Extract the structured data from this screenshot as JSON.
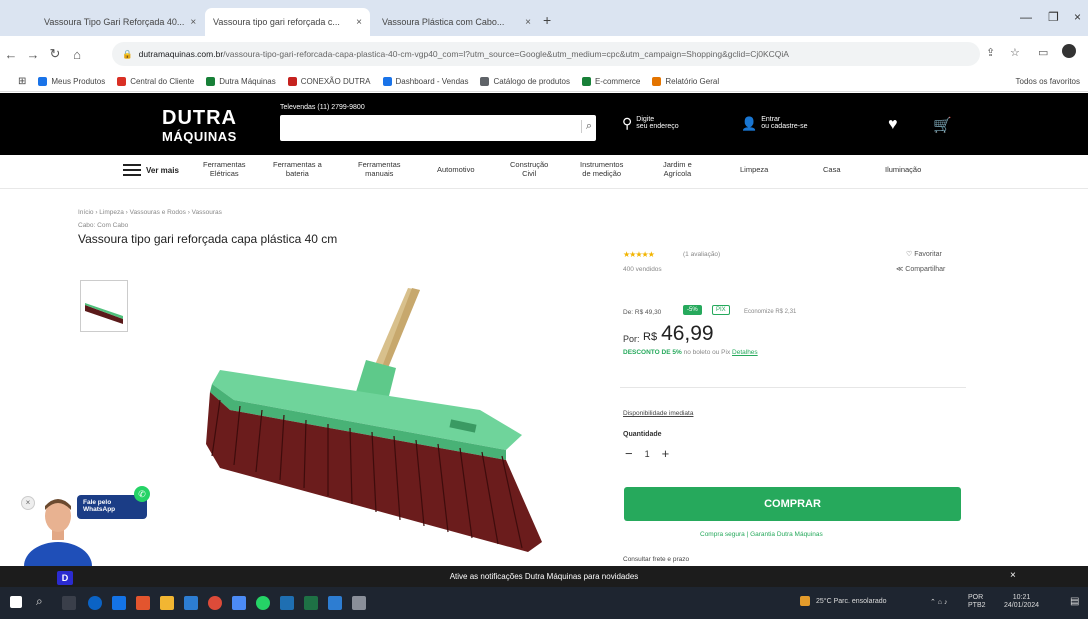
{
  "browser": {
    "tabs": [
      {
        "title": "Vassoura Tipo Gari Reforçada 40...",
        "color": "#e8a000"
      },
      {
        "title": "Vassoura tipo gari reforçada c...",
        "color": "#1a3d8f"
      },
      {
        "title": "Vassoura Plástica com Cabo...",
        "color": "#d0302c"
      }
    ],
    "url_host": "dutramaquinas.com.br",
    "url_path": "/vassoura-tipo-gari-reforcada-capa-plastica-40-cm-vgp40_com=l?utm_source=Google&utm_medium=cpc&utm_campaign=Shopping&gclid=Cj0KCQiA",
    "bookmarks": [
      {
        "label": "Meus Produtos",
        "color": "#1a73e8"
      },
      {
        "label": "Central do Cliente",
        "color": "#d93025"
      },
      {
        "label": "Dutra Máquinas",
        "color": "#188038"
      },
      {
        "label": "CONEXÃO DUTRA",
        "color": "#c5221f"
      },
      {
        "label": "Dashboard - Vendas",
        "color": "#1a73e8"
      },
      {
        "label": "Catálogo de produtos",
        "color": "#5f6368"
      },
      {
        "label": "E-commerce",
        "color": "#188038"
      },
      {
        "label": "Relatório Geral",
        "color": "#e37400"
      }
    ],
    "other_bookmarks": "Todos os favoritos"
  },
  "site": {
    "logo_line1": "DUTRA",
    "logo_line2": "MÁQUINAS",
    "phone": "Televendas (11) 2799-9800",
    "location_line1": "Digite",
    "location_line2": "seu endereço",
    "account_line1": "Entrar",
    "account_line2": "ou cadastre-se",
    "menu_label": "Ver mais",
    "categories": [
      "Ferramentas\nElétricas",
      "Ferramentas a\nbateria",
      "Ferramentas\nmanuais",
      "Automotivo",
      "Construção\nCivil",
      "Instrumentos\nde medição",
      "Jardim e\nAgrícola",
      "Limpeza",
      "Casa",
      "Iluminação"
    ]
  },
  "product": {
    "breadcrumb": "Início › Limpeza › Vassouras e Rodos › Vassouras",
    "category": "Cabo: Com Cabo",
    "title": "Vassoura tipo gari reforçada capa plástica 40 cm",
    "stars": "★★★★★",
    "reviews": "(1 avaliação)",
    "sold": "400 vendidos",
    "favorite": "♡ Favoritar",
    "share": "≪ Compartilhar",
    "old_price": "De: R$ 49,30",
    "badge_discount": "-5%",
    "badge_pix": "PIX",
    "economy": "Economize R$ 2,31",
    "price_prefix": "Por:",
    "currency": "R$",
    "price": "46,99",
    "pix_discount": "DESCONTO DE 5%",
    "pix_note": "no boleto ou Pix",
    "pix_link": "Detalhes",
    "availability": "Disponibilidade imediata",
    "quantity_label": "Quantidade",
    "quantity": "1",
    "buy_label": "COMPRAR",
    "secure": "Compra segura | Garantia Dutra Máquinas",
    "shipping": "Consultar frete e prazo"
  },
  "whatsapp": {
    "line1": "Fale pelo",
    "line2": "WhatsApp"
  },
  "banner": {
    "text": "Ative as notificações Dutra Máquinas para novidades",
    "badge": "D"
  },
  "taskbar": {
    "weather": "25°C Parc. ensolarado",
    "time": "10:21",
    "date": "24/01/2024",
    "lang": "POR PTB2"
  },
  "colors": {
    "accent_green": "#26a95c",
    "header_black": "#000000",
    "star_yellow": "#f2b400"
  }
}
